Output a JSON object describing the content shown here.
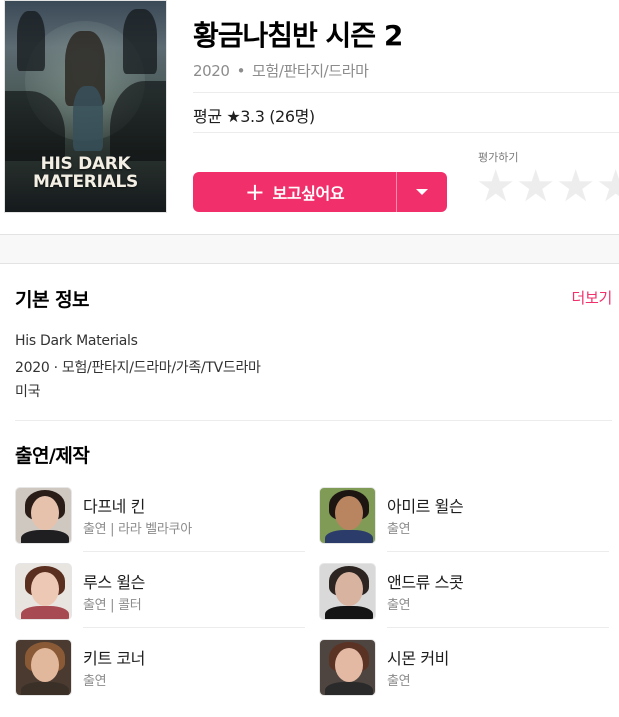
{
  "poster": {
    "text_line1": "HIS DARK",
    "text_line2": "MATERIALS"
  },
  "header": {
    "title": "황금나침반 시즌 2",
    "year": "2020",
    "separator": "•",
    "genres": "모험/판타지/드라마",
    "average_rating": "평균 ★3.3 (26명)",
    "rate_label": "평가하기",
    "star_rating_value": 0,
    "star_count": 5,
    "wish_button_label": "보고싶어요",
    "plus_icon": "+",
    "accent_color": "#f1306b"
  },
  "basic_info": {
    "title": "기본 정보",
    "more_link": "더보기",
    "original_title": "His Dark Materials",
    "details": "2020 · 모험/판타지/드라마/가족/TV드라마",
    "country": "미국"
  },
  "cast": {
    "title": "출연/제작",
    "people": [
      {
        "name": "다프네 킨",
        "role": "출연 | 라라 벨라쿠아"
      },
      {
        "name": "아미르 윌슨",
        "role": "출연"
      },
      {
        "name": "루스 윌슨",
        "role": "출연 | 콜터"
      },
      {
        "name": "앤드류 스콧",
        "role": "출연"
      },
      {
        "name": "키트 코너",
        "role": "출연"
      },
      {
        "name": "시몬 커비",
        "role": "출연"
      }
    ]
  }
}
